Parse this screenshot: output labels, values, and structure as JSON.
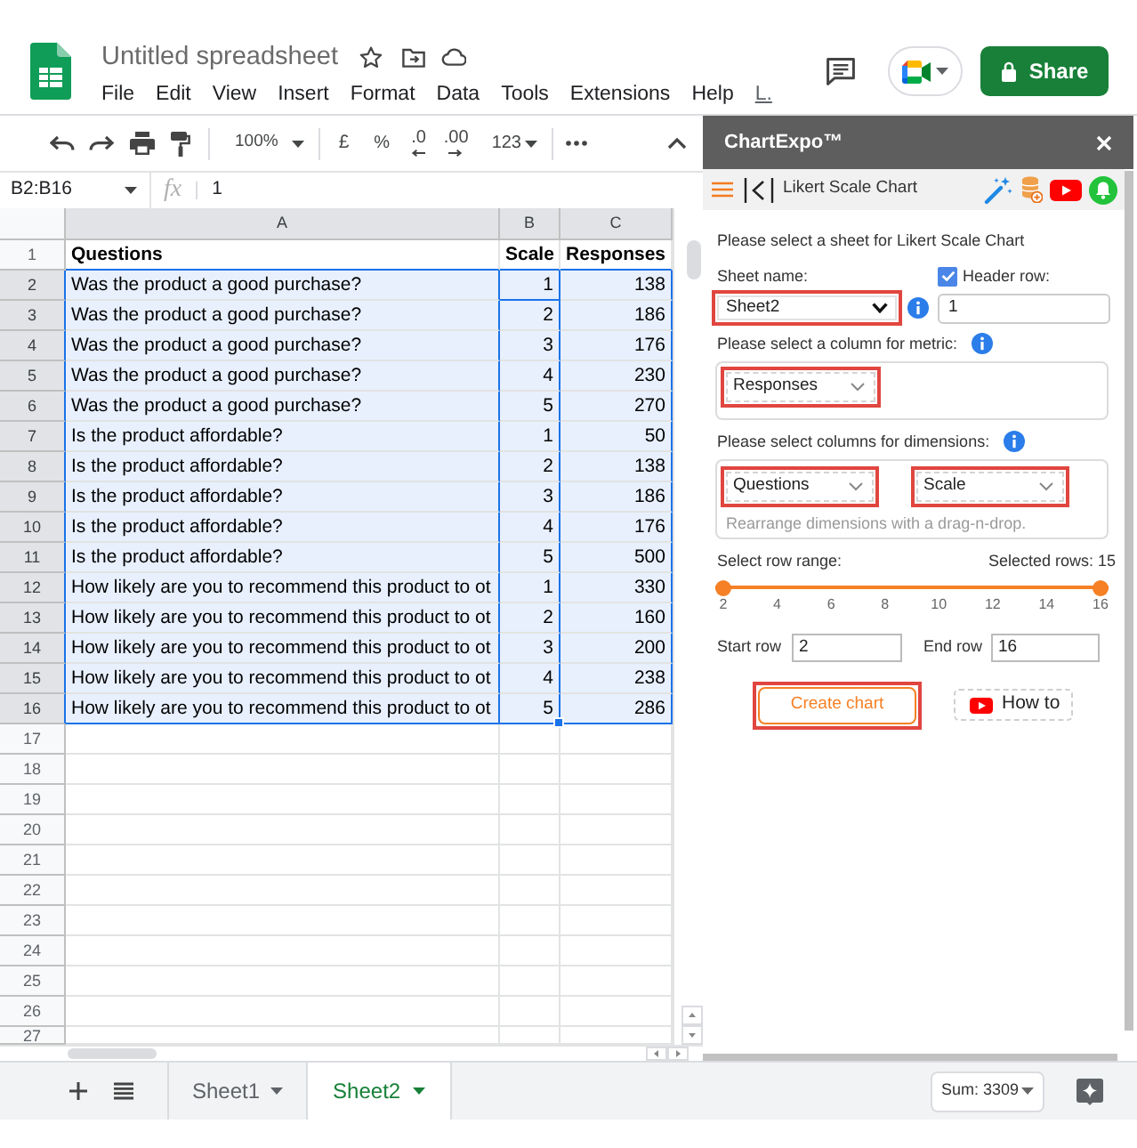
{
  "header": {
    "title": "Untitled spreadsheet",
    "menu": [
      {
        "label": "File",
        "kind": "menu"
      },
      {
        "label": "Edit",
        "kind": "menu"
      },
      {
        "label": "View",
        "kind": "menu"
      },
      {
        "label": "Insert",
        "kind": "menu"
      },
      {
        "label": "Format",
        "kind": "menu"
      },
      {
        "label": "Data",
        "kind": "menu"
      },
      {
        "label": "Tools",
        "kind": "menu"
      },
      {
        "label": "Extensions",
        "kind": "menu"
      },
      {
        "label": "Help",
        "kind": "menu"
      },
      {
        "label": "L.",
        "kind": "link"
      }
    ],
    "share_label": "Share"
  },
  "toolbar": {
    "zoom": "100%",
    "currency": "£",
    "percent": "%",
    "decimals_decrease": ".0",
    "decimals_increase": ".00",
    "number_format": "123"
  },
  "formula_bar": {
    "name_box": "B2:B16",
    "fx": "fx",
    "value": "1"
  },
  "grid": {
    "columns": [
      {
        "label": "A",
        "selected": true,
        "active": false,
        "kind": "text"
      },
      {
        "label": "B",
        "selected": true,
        "active": true,
        "kind": "number"
      },
      {
        "label": "C",
        "selected": true,
        "active": false,
        "kind": "number"
      }
    ],
    "rows": [
      {
        "number": "1",
        "selected": false,
        "kind": "header",
        "cells": [
          "Questions",
          "Scale",
          "Responses"
        ]
      },
      {
        "number": "2",
        "selected": true,
        "kind": "data",
        "cells": [
          "Was the product a good purchase?",
          "1",
          "138"
        ]
      },
      {
        "number": "3",
        "selected": true,
        "kind": "data",
        "cells": [
          "Was the product a good purchase?",
          "2",
          "186"
        ]
      },
      {
        "number": "4",
        "selected": true,
        "kind": "data",
        "cells": [
          "Was the product a good purchase?",
          "3",
          "176"
        ]
      },
      {
        "number": "5",
        "selected": true,
        "kind": "data",
        "cells": [
          "Was the product a good purchase?",
          "4",
          "230"
        ]
      },
      {
        "number": "6",
        "selected": true,
        "kind": "data",
        "cells": [
          "Was the product a good purchase?",
          "5",
          "270"
        ]
      },
      {
        "number": "7",
        "selected": true,
        "kind": "data",
        "cells": [
          "Is the product affordable?",
          "1",
          "50"
        ]
      },
      {
        "number": "8",
        "selected": true,
        "kind": "data",
        "cells": [
          "Is the product affordable?",
          "2",
          "138"
        ]
      },
      {
        "number": "9",
        "selected": true,
        "kind": "data",
        "cells": [
          "Is the product affordable?",
          "3",
          "186"
        ]
      },
      {
        "number": "10",
        "selected": true,
        "kind": "data",
        "cells": [
          "Is the product affordable?",
          "4",
          "176"
        ]
      },
      {
        "number": "11",
        "selected": true,
        "kind": "data",
        "cells": [
          "Is the product affordable?",
          "5",
          "500"
        ]
      },
      {
        "number": "12",
        "selected": true,
        "kind": "data",
        "cells": [
          "How likely are you to recommend this product to ot",
          "1",
          "330"
        ]
      },
      {
        "number": "13",
        "selected": true,
        "kind": "data",
        "cells": [
          "How likely are you to recommend this product to ot",
          "2",
          "160"
        ]
      },
      {
        "number": "14",
        "selected": true,
        "kind": "data",
        "cells": [
          "How likely are you to recommend this product to ot",
          "3",
          "200"
        ]
      },
      {
        "number": "15",
        "selected": true,
        "kind": "data",
        "cells": [
          "How likely are you to recommend this product to ot",
          "4",
          "238"
        ]
      },
      {
        "number": "16",
        "selected": true,
        "kind": "data",
        "cells": [
          "How likely are you to recommend this product to ot",
          "5",
          "286"
        ]
      },
      {
        "number": "17",
        "selected": false,
        "kind": "empty"
      },
      {
        "number": "18",
        "selected": false,
        "kind": "empty"
      },
      {
        "number": "19",
        "selected": false,
        "kind": "empty"
      },
      {
        "number": "20",
        "selected": false,
        "kind": "empty"
      },
      {
        "number": "21",
        "selected": false,
        "kind": "empty"
      },
      {
        "number": "22",
        "selected": false,
        "kind": "empty"
      },
      {
        "number": "23",
        "selected": false,
        "kind": "empty"
      },
      {
        "number": "24",
        "selected": false,
        "kind": "empty"
      },
      {
        "number": "25",
        "selected": false,
        "kind": "empty"
      },
      {
        "number": "26",
        "selected": false,
        "kind": "empty"
      },
      {
        "number": "27",
        "selected": false,
        "kind": "empty"
      }
    ]
  },
  "sheet_tabs": [
    {
      "label": "Sheet1",
      "selected": false
    },
    {
      "label": "Sheet2",
      "selected": true
    }
  ],
  "status": {
    "sum": "Sum: 3309"
  },
  "side_panel": {
    "title": "ChartExpo™",
    "chart_name": "Likert Scale Chart",
    "intro": "Please select a sheet for Likert Scale Chart",
    "sheet_label": "Sheet name:",
    "sheet_select": {
      "value": "Sheet2",
      "highlighted": true
    },
    "header_row": {
      "label": "Header row:",
      "checked": true,
      "value": "1"
    },
    "metric_label": "Please select a column for metric:",
    "metric_select": {
      "value": "Responses",
      "highlighted": true
    },
    "dimensions_label": "Please select columns for dimensions:",
    "dimension_selects": [
      {
        "value": "Questions",
        "highlighted": true
      },
      {
        "value": "Scale",
        "highlighted": true
      }
    ],
    "dimensions_hint": "Rearrange dimensions with a drag-n-drop.",
    "range_label": "Select row range:",
    "selected_rows": "Selected rows: 15",
    "range_slider": {
      "level": 1,
      "ticks": [
        "2",
        "4",
        "6",
        "8",
        "10",
        "12",
        "14",
        "16"
      ]
    },
    "start_row": {
      "label": "Start row",
      "value": "2"
    },
    "end_row": {
      "label": "End row",
      "value": "16"
    },
    "buttons": [
      {
        "label": "Create chart",
        "kind": "primary",
        "highlighted": true
      },
      {
        "label": "How to",
        "kind": "video",
        "highlighted": false
      }
    ]
  }
}
